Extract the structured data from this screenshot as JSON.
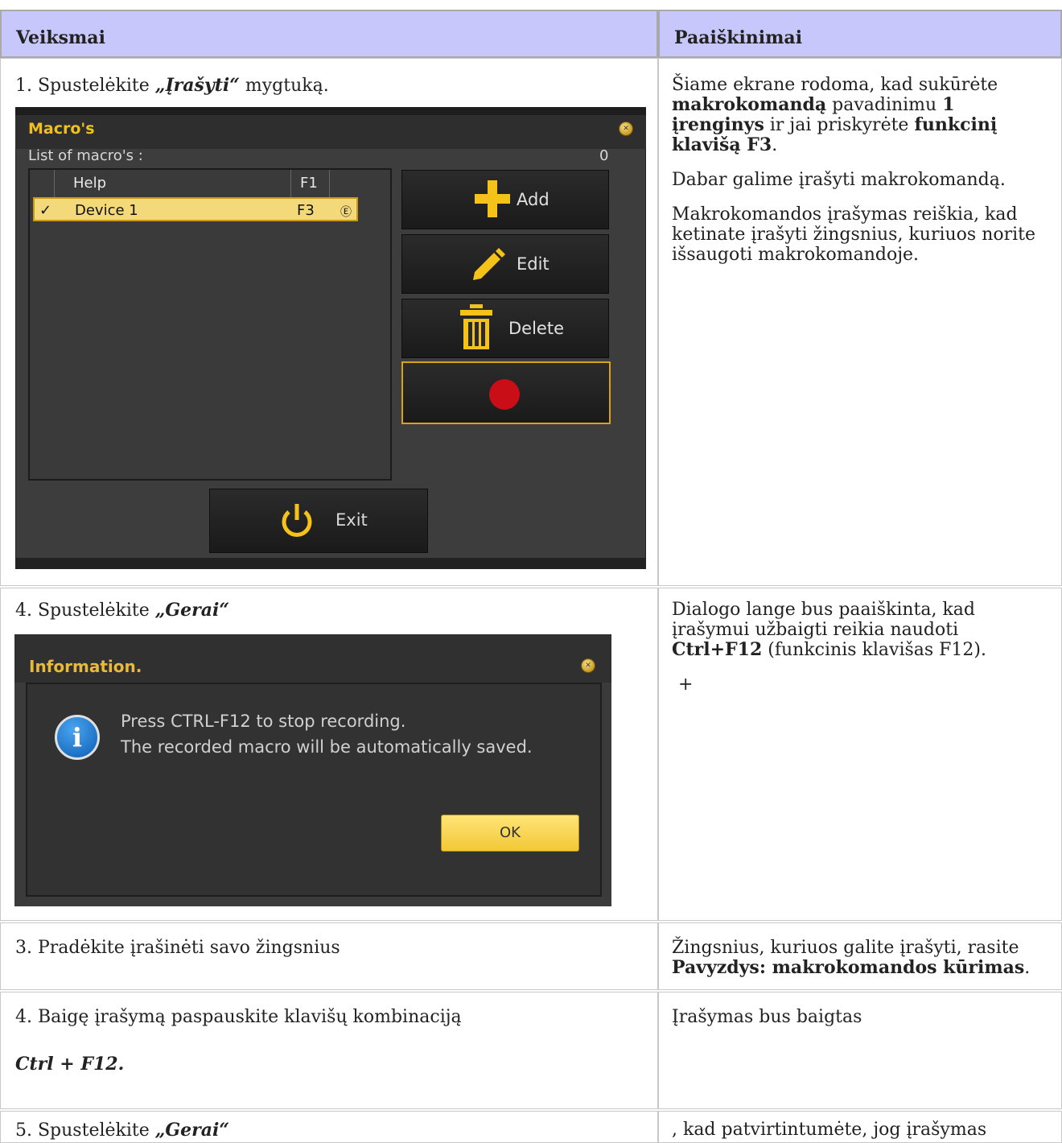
{
  "table": {
    "headers": {
      "left": "Veiksmai",
      "right": "Paaiškinimai"
    },
    "row1": {
      "step_prefix": "1. Spustelėkite ",
      "step_bold": "„Įrašyti“",
      "step_suffix": " mygtuką.",
      "right": {
        "p1_a": "Šiame ekrane rodoma, kad sukūrėte ",
        "p1_b": "makrokomandą",
        "p1_c": " pavadinimu ",
        "p1_d": "1 įrenginys",
        "p1_e": " ir jai priskyrėte ",
        "p1_f": "funkcinį klavišą F3",
        "p1_g": ".",
        "p2": "Dabar galime įrašyti makrokomandą.",
        "p3": "Makrokomandos įrašymas reiškia, kad ketinate įrašyti žingsnius, kuriuos norite išsaugoti makrokomandoje."
      }
    },
    "row2": {
      "step_prefix": "4. Spustelėkite ",
      "step_bold": "„Gerai“",
      "right": {
        "p1_a": "Dialogo lange bus paaiškinta, kad įrašymui užbaigti reikia naudoti ",
        "p1_b": "Ctrl+F12",
        "p1_c": " (funkcinis klavišas F12).",
        "p2": "+"
      }
    },
    "row3": {
      "step": "3. Pradėkite įrašinėti savo žingsnius",
      "right_a": "Žingsnius, kuriuos galite įrašyti, rasite ",
      "right_b": "Pavyzdys: makrokomandos kūrimas",
      "right_c": "."
    },
    "row4": {
      "step": "4. Baigę įrašymą paspauskite klavišų kombinaciją",
      "keys": "Ctrl + F12.",
      "right": "Įrašymas bus baigtas"
    },
    "row5": {
      "step_prefix": "5. Spustelėkite ",
      "step_bold": "„Gerai“",
      "right": ", kad patvirtintumėte, jog įrašymas"
    }
  },
  "macro_dialog": {
    "title": "Macro's",
    "list_label": "List of macro's :",
    "count": "0",
    "rows": [
      {
        "name": "Help",
        "key": "F1",
        "check": ""
      },
      {
        "name": "Device 1",
        "key": "F3",
        "check": "✓"
      }
    ],
    "buttons": {
      "add": "Add",
      "edit": "Edit",
      "delete": "Delete",
      "exit": "Exit"
    }
  },
  "info_dialog": {
    "title": "Information.",
    "line1": "Press CTRL-F12 to stop recording.",
    "line2": "The recorded macro will be automatically saved.",
    "ok": "OK"
  },
  "colors": {
    "header_bg": "#c7c7fb",
    "accent": "#f0c020",
    "record": "#c90e18",
    "info_blue": "#1a6fc2"
  }
}
